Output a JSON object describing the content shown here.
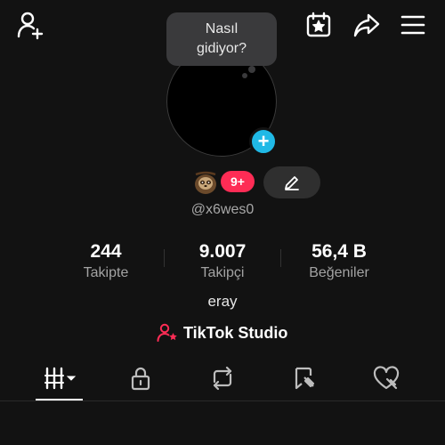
{
  "header": {
    "icons": [
      "add-friend-icon",
      "calendar-star-icon",
      "share-icon",
      "menu-icon"
    ]
  },
  "bubble": {
    "line1": "Nasıl",
    "line2": "gidiyor?"
  },
  "profile": {
    "notification_badge": "9+",
    "username": "@x6wes0",
    "display_name": "eray"
  },
  "stats": [
    {
      "value": "244",
      "label": "Takipte"
    },
    {
      "value": "9.007",
      "label": "Takipçi"
    },
    {
      "value": "56,4 B",
      "label": "Beğeniler"
    }
  ],
  "studio": {
    "label": "TikTok Studio"
  },
  "tabs": [
    "videos-grid-icon",
    "lock-icon",
    "repost-icon",
    "saved-icon",
    "liked-icon"
  ],
  "colors": {
    "background": "#121212",
    "accent_blue": "#20b9e6",
    "accent_pink": "#fe2c55",
    "muted_text": "#a3a3a3"
  }
}
